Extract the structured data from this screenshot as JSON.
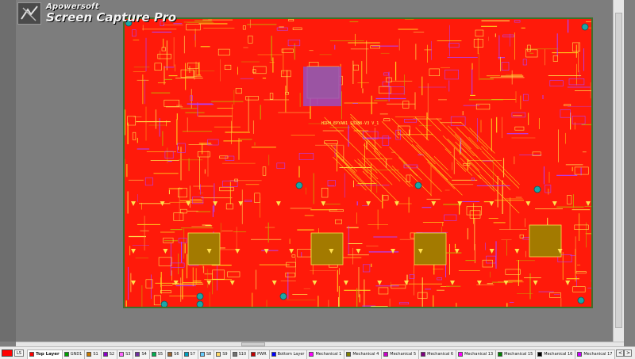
{
  "watermark": {
    "brand": "Apowersoft",
    "product": "Screen Capture Pro"
  },
  "board": {
    "silk_label": "HIPH_EPYAN1 S3288-V3 V_1"
  },
  "statusbar": {
    "current_layer_color": "#ff0000",
    "ls_label": "LS",
    "layers": [
      {
        "name": "Top Layer",
        "color": "#ff0000",
        "active": true
      },
      {
        "name": "GND1",
        "color": "#00a000"
      },
      {
        "name": "S1",
        "color": "#c87800"
      },
      {
        "name": "S2",
        "color": "#8c00c8"
      },
      {
        "name": "S3",
        "color": "#ff66ff"
      },
      {
        "name": "S4",
        "color": "#7030a0"
      },
      {
        "name": "S5",
        "color": "#00b050"
      },
      {
        "name": "S6",
        "color": "#996633"
      },
      {
        "name": "S7",
        "color": "#00a0c0"
      },
      {
        "name": "S8",
        "color": "#66ccff"
      },
      {
        "name": "S9",
        "color": "#ffd966"
      },
      {
        "name": "S10",
        "color": "#707070"
      },
      {
        "name": "PWR",
        "color": "#c00000"
      },
      {
        "name": "Bottom Layer",
        "color": "#0000ff"
      },
      {
        "name": "Mechanical 1",
        "color": "#ff00ff"
      },
      {
        "name": "Mechanical 4",
        "color": "#808000"
      },
      {
        "name": "Mechanical 5",
        "color": "#cc00cc"
      },
      {
        "name": "Mechanical 6",
        "color": "#800080"
      },
      {
        "name": "Mechanical 13",
        "color": "#ff00ff"
      },
      {
        "name": "Mechanical 15",
        "color": "#008000"
      },
      {
        "name": "Mechanical 16",
        "color": "#000000"
      },
      {
        "name": "Mechanical 17",
        "color": "#cc00ff"
      }
    ],
    "nav": [
      "<",
      ">"
    ]
  }
}
